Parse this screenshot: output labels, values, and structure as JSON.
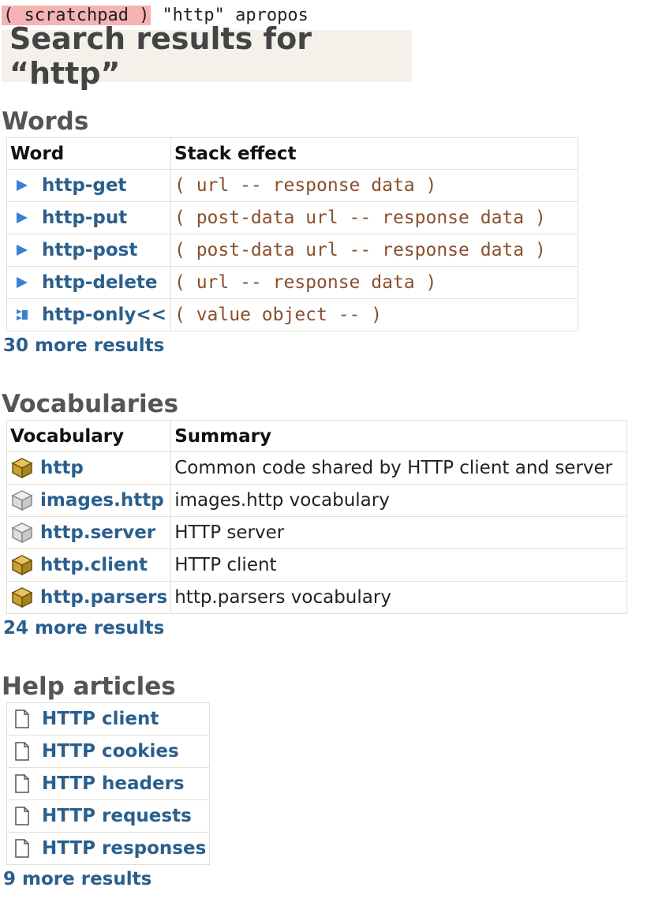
{
  "prompt": {
    "scratchpad_label": "( scratchpad )",
    "query": "\"http\" apropos"
  },
  "page_title": "Search results for “http”",
  "colors": {
    "link": "#2a5f8d",
    "stack_effect": "#8a4f2c",
    "scratchpad_bg": "#f6b3b3",
    "title_bg": "#f3f1ea"
  },
  "words": {
    "heading": "Words",
    "columns": [
      "Word",
      "Stack effect"
    ],
    "rows": [
      {
        "icon": "triangle-play-icon",
        "name": "http-get",
        "effect": "( url -- response data )"
      },
      {
        "icon": "triangle-play-icon",
        "name": "http-put",
        "effect": "( post-data url -- response data )"
      },
      {
        "icon": "triangle-play-icon",
        "name": "http-post",
        "effect": "( post-data url -- response data )"
      },
      {
        "icon": "triangle-play-icon",
        "name": "http-delete",
        "effect": "( url -- response data )"
      },
      {
        "icon": "generic-word-icon",
        "name": "http-only<<",
        "effect": "( value object -- )"
      }
    ],
    "more": "30 more results"
  },
  "vocabularies": {
    "heading": "Vocabularies",
    "columns": [
      "Vocabulary",
      "Summary"
    ],
    "rows": [
      {
        "icon": "vocab-box-loaded-icon",
        "name": "http",
        "summary": "Common code shared by HTTP client and server"
      },
      {
        "icon": "vocab-box-unloaded-icon",
        "name": "images.http",
        "summary": "images.http vocabulary"
      },
      {
        "icon": "vocab-box-unloaded-icon",
        "name": "http.server",
        "summary": "HTTP server"
      },
      {
        "icon": "vocab-box-loaded-icon",
        "name": "http.client",
        "summary": "HTTP client"
      },
      {
        "icon": "vocab-box-loaded-icon",
        "name": "http.parsers",
        "summary": "http.parsers vocabulary"
      }
    ],
    "more": "24 more results"
  },
  "help_articles": {
    "heading": "Help articles",
    "rows": [
      {
        "icon": "document-icon",
        "name": "HTTP client"
      },
      {
        "icon": "document-icon",
        "name": "HTTP cookies"
      },
      {
        "icon": "document-icon",
        "name": "HTTP headers"
      },
      {
        "icon": "document-icon",
        "name": "HTTP requests"
      },
      {
        "icon": "document-icon",
        "name": "HTTP responses"
      }
    ],
    "more": "9 more results"
  }
}
